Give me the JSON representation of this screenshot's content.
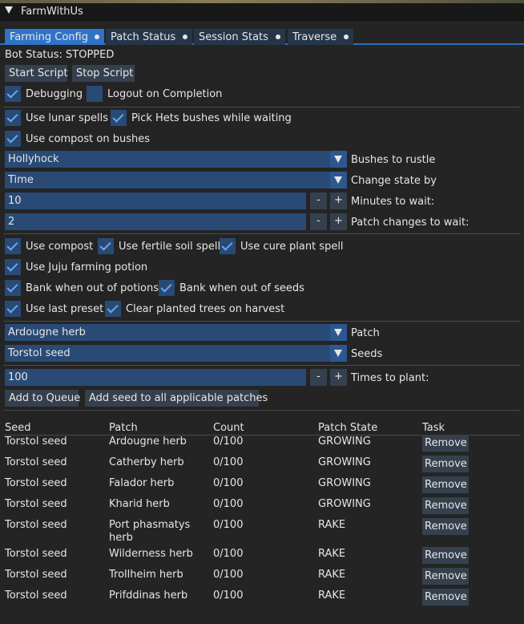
{
  "window": {
    "title": "FarmWithUs"
  },
  "tabs": [
    {
      "label": "Farming Config",
      "active": true
    },
    {
      "label": "Patch Status",
      "active": false
    },
    {
      "label": "Session Stats",
      "active": false
    },
    {
      "label": "Traverse",
      "active": false
    }
  ],
  "status": {
    "text": "Bot Status: STOPPED"
  },
  "buttons": {
    "start": "Start Script",
    "stop": "Stop Script",
    "add_queue": "Add to Queue",
    "add_all": "Add seed to all applicable patches"
  },
  "options": {
    "debugging": {
      "label": "Debugging",
      "checked": true
    },
    "logout": {
      "label": "Logout on Completion",
      "checked": false
    },
    "lunar": {
      "label": "Use lunar spells",
      "checked": true
    },
    "hets": {
      "label": "Pick Hets bushes while waiting",
      "checked": true
    },
    "compost_bushes": {
      "label": "Use compost on bushes",
      "checked": true
    },
    "compost": {
      "label": "Use compost",
      "checked": true
    },
    "fertile": {
      "label": "Use fertile soil spell",
      "checked": true
    },
    "cure": {
      "label": "Use cure plant spell",
      "checked": true
    },
    "juju": {
      "label": "Use Juju farming potion",
      "checked": true
    },
    "bank_potions": {
      "label": "Bank when out of potions",
      "checked": true
    },
    "bank_seeds": {
      "label": "Bank when out of seeds",
      "checked": true
    },
    "last_preset": {
      "label": "Use last preset",
      "checked": true
    },
    "clear_trees": {
      "label": "Clear planted trees on harvest",
      "checked": true
    }
  },
  "fields": {
    "bush": {
      "value": "Hollyhock",
      "label": "Bushes to rustle"
    },
    "state": {
      "value": "Time",
      "label": "Change state by"
    },
    "minutes": {
      "value": "10",
      "label": "Minutes to wait:"
    },
    "patch_changes": {
      "value": "2",
      "label": "Patch changes to wait:"
    },
    "patch": {
      "value": "Ardougne herb",
      "label": "Patch"
    },
    "seeds": {
      "value": "Torstol seed",
      "label": "Seeds"
    },
    "times": {
      "value": "100",
      "label": "Times to plant:"
    },
    "minus": "-",
    "plus": "+"
  },
  "table": {
    "headers": [
      "Seed",
      "Patch",
      "Count",
      "Patch State",
      "Task"
    ],
    "remove_label": "Remove",
    "rows": [
      {
        "seed": "Torstol seed",
        "patch": "Ardougne herb",
        "count": "0/100",
        "state": "GROWING"
      },
      {
        "seed": "Torstol seed",
        "patch": "Catherby herb",
        "count": "0/100",
        "state": "GROWING"
      },
      {
        "seed": "Torstol seed",
        "patch": "Falador herb",
        "count": "0/100",
        "state": "GROWING"
      },
      {
        "seed": "Torstol seed",
        "patch": "Kharid herb",
        "count": "0/100",
        "state": "GROWING"
      },
      {
        "seed": "Torstol seed",
        "patch": "Port phasmatys herb",
        "count": "0/100",
        "state": "RAKE"
      },
      {
        "seed": "Torstol seed",
        "patch": "Wilderness herb",
        "count": "0/100",
        "state": "RAKE"
      },
      {
        "seed": "Torstol seed",
        "patch": "Trollheim herb",
        "count": "0/100",
        "state": "RAKE"
      },
      {
        "seed": "Torstol seed",
        "patch": "Prifddinas herb",
        "count": "0/100",
        "state": "RAKE"
      }
    ]
  },
  "colors": {
    "accent": "#2f73c8",
    "field": "#294a75",
    "check": "#66a8f0",
    "button": "#35404e"
  }
}
